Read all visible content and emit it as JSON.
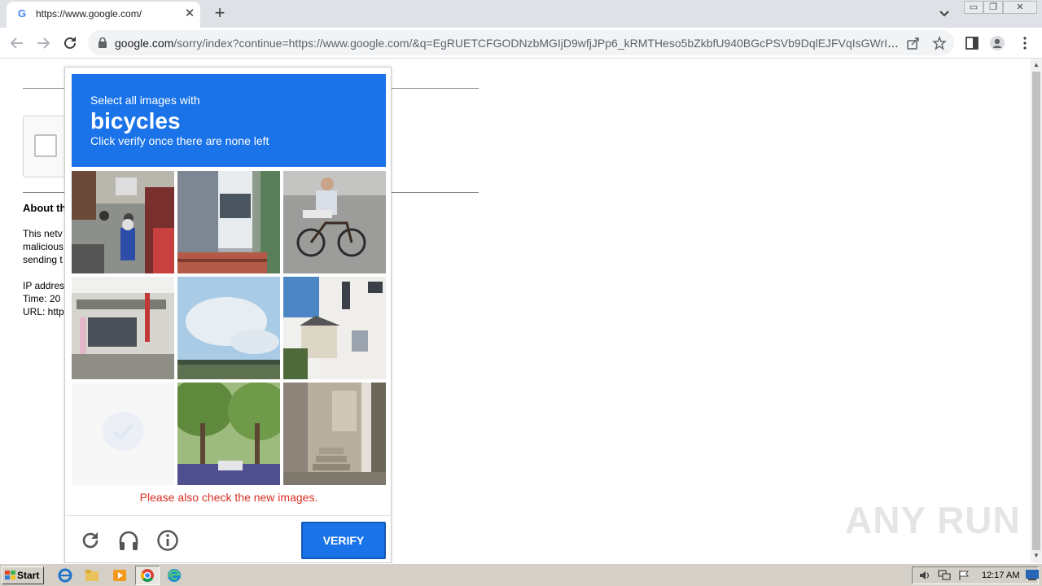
{
  "browser": {
    "tab_title": "https://www.google.com/",
    "tab_favicon": "G",
    "url_host": "google.com",
    "url_rest": "/sorry/index?continue=https://www.google.com/&q=EgRUETCFGODNzbMGIjD9wfjJPp6_kRMTHeso5bZkbfU940BGcPSVb9DqlEJFVqIsGWrIeLui..."
  },
  "page": {
    "about_heading": "About th",
    "info_lines": [
      "This netv",
      "malicious",
      "sending t",
      "IP addres",
      "Time: 20",
      "URL: http"
    ]
  },
  "captcha": {
    "instruction": "Select all images with",
    "keyword": "bicycles",
    "subtext": "Click verify once there are none left",
    "error": "Please also check the new images.",
    "verify_label": "VERIFY",
    "tiles": [
      "street-motorcycles",
      "bus-and-pole",
      "man-riding-bicycle",
      "storefront",
      "sky-and-bridge",
      "house",
      "faded-new-tile",
      "tree-lined-street",
      "alley-with-steps"
    ]
  },
  "taskbar": {
    "start_label": "Start",
    "clock": "12:17 AM"
  },
  "watermark": "ANY RUN"
}
